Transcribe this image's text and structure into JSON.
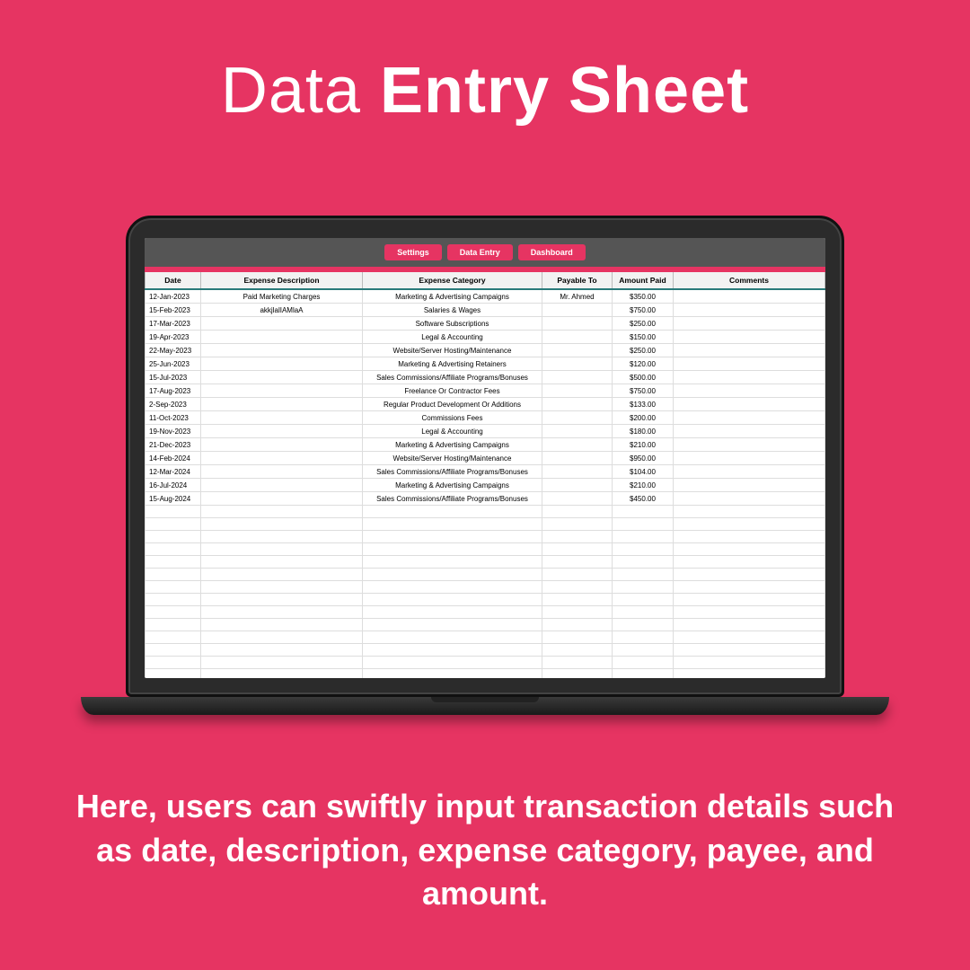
{
  "title_light": "Data ",
  "title_bold": "Entry Sheet",
  "subtitle": "Here, users can swiftly input transaction details such as date, description, expense category, payee, and amount.",
  "tabs": {
    "settings": "Settings",
    "data_entry": "Data Entry",
    "dashboard": "Dashboard"
  },
  "columns": {
    "date": "Date",
    "desc": "Expense Description",
    "cat": "Expense Category",
    "payto": "Payable To",
    "amount": "Amount Paid",
    "comm": "Comments"
  },
  "rows": [
    {
      "date": "12-Jan-2023",
      "desc": "Paid Marketing Charges",
      "cat": "Marketing & Advertising Campaigns",
      "payto": "Mr. Ahmed",
      "amount": "$350.00",
      "comm": ""
    },
    {
      "date": "15-Feb-2023",
      "desc": "akkjlalIAMlaA",
      "cat": "Salaries & Wages",
      "payto": "",
      "amount": "$750.00",
      "comm": ""
    },
    {
      "date": "17-Mar-2023",
      "desc": "",
      "cat": "Software Subscriptions",
      "payto": "",
      "amount": "$250.00",
      "comm": ""
    },
    {
      "date": "19-Apr-2023",
      "desc": "",
      "cat": "Legal & Accounting",
      "payto": "",
      "amount": "$150.00",
      "comm": ""
    },
    {
      "date": "22-May-2023",
      "desc": "",
      "cat": "Website/Server Hosting/Maintenance",
      "payto": "",
      "amount": "$250.00",
      "comm": ""
    },
    {
      "date": "25-Jun-2023",
      "desc": "",
      "cat": "Marketing & Advertising Retainers",
      "payto": "",
      "amount": "$120.00",
      "comm": ""
    },
    {
      "date": "15-Jul-2023",
      "desc": "",
      "cat": "Sales Commissions/Affiliate Programs/Bonuses",
      "payto": "",
      "amount": "$500.00",
      "comm": ""
    },
    {
      "date": "17-Aug-2023",
      "desc": "",
      "cat": "Freelance Or Contractor Fees",
      "payto": "",
      "amount": "$750.00",
      "comm": ""
    },
    {
      "date": "2-Sep-2023",
      "desc": "",
      "cat": "Regular Product Development Or Additions",
      "payto": "",
      "amount": "$133.00",
      "comm": ""
    },
    {
      "date": "11-Oct-2023",
      "desc": "",
      "cat": "Commissions Fees",
      "payto": "",
      "amount": "$200.00",
      "comm": ""
    },
    {
      "date": "19-Nov-2023",
      "desc": "",
      "cat": "Legal & Accounting",
      "payto": "",
      "amount": "$180.00",
      "comm": ""
    },
    {
      "date": "21-Dec-2023",
      "desc": "",
      "cat": "Marketing & Advertising Campaigns",
      "payto": "",
      "amount": "$210.00",
      "comm": ""
    },
    {
      "date": "14-Feb-2024",
      "desc": "",
      "cat": "Website/Server Hosting/Maintenance",
      "payto": "",
      "amount": "$950.00",
      "comm": ""
    },
    {
      "date": "12-Mar-2024",
      "desc": "",
      "cat": "Sales Commissions/Affiliate Programs/Bonuses",
      "payto": "",
      "amount": "$104.00",
      "comm": ""
    },
    {
      "date": "16-Jul-2024",
      "desc": "",
      "cat": "Marketing & Advertising Campaigns",
      "payto": "",
      "amount": "$210.00",
      "comm": ""
    },
    {
      "date": "15-Aug-2024",
      "desc": "",
      "cat": "Sales Commissions/Affiliate Programs/Bonuses",
      "payto": "",
      "amount": "$450.00",
      "comm": ""
    }
  ],
  "empty_rows": 14
}
